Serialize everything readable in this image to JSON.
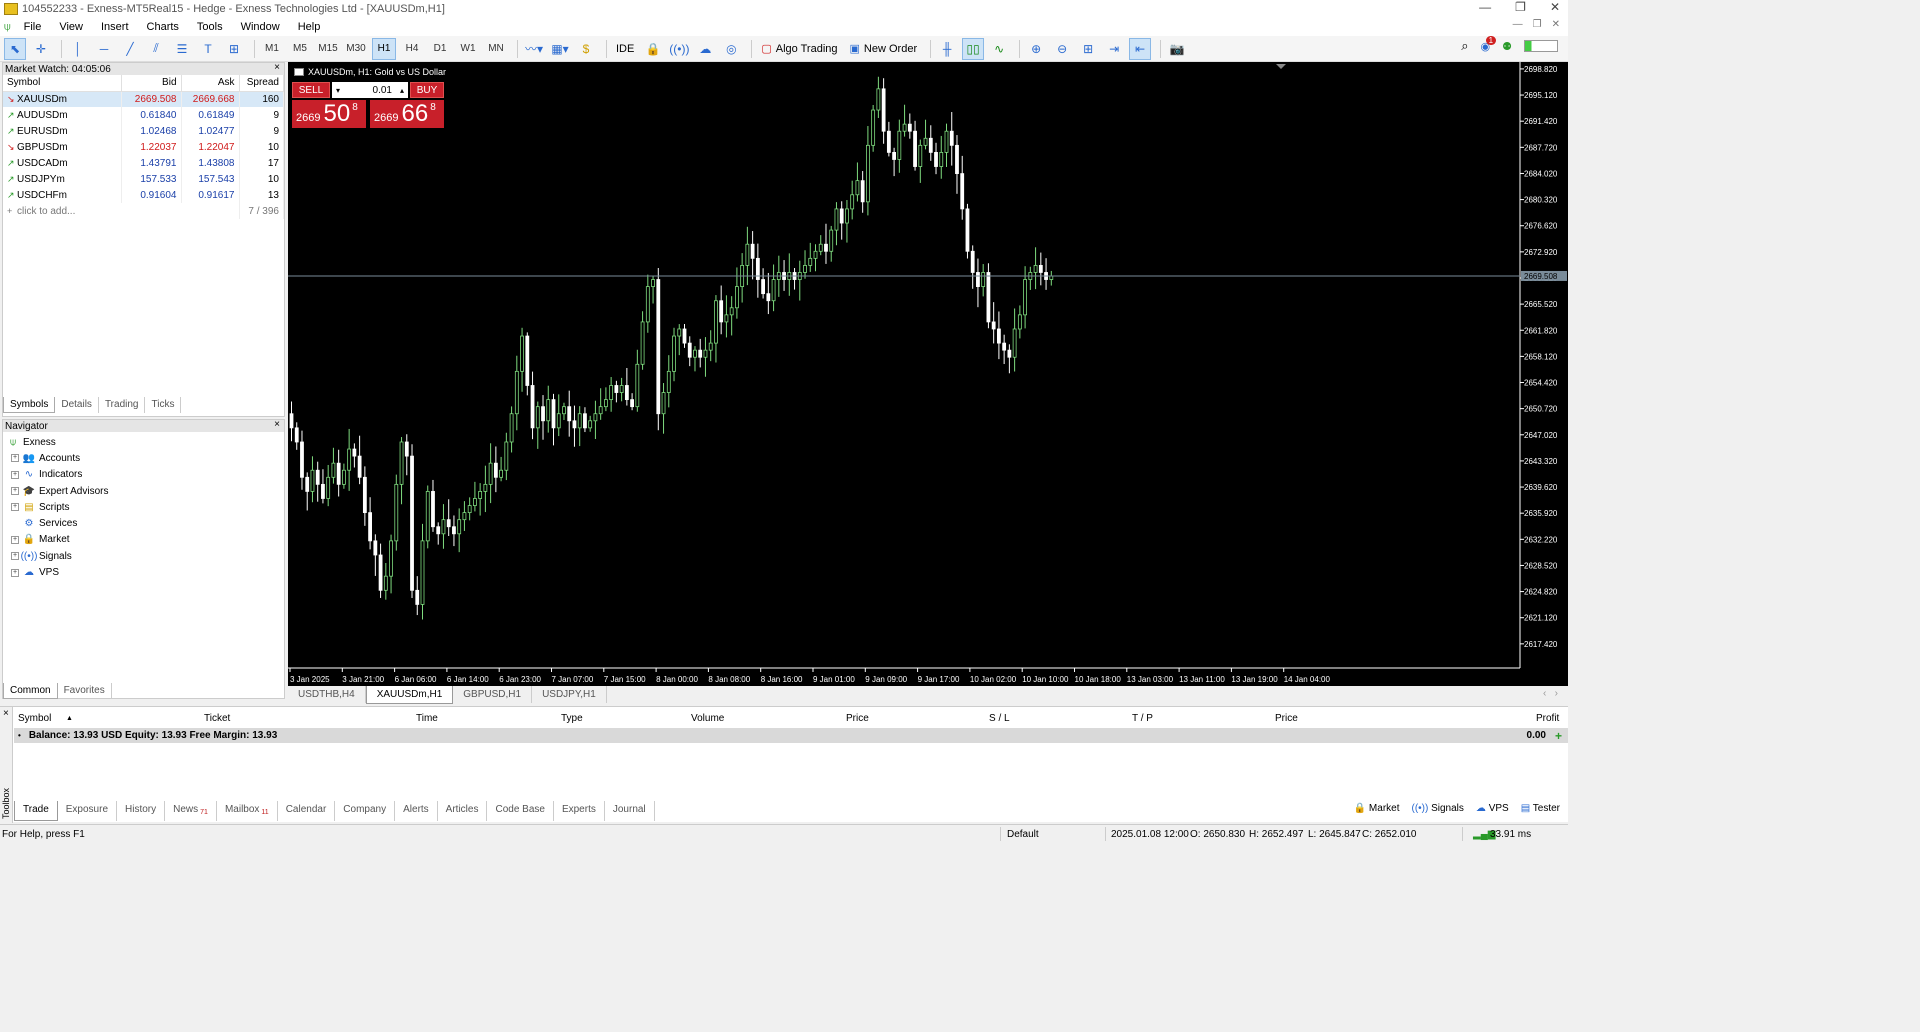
{
  "window": {
    "title": "104552233 - Exness-MT5Real15 - Hedge - Exness Technologies Ltd - [XAUUSDm,H1]",
    "min_glyph": "—",
    "restore_glyph": "❐",
    "close_glyph": "✕"
  },
  "menu": [
    "File",
    "View",
    "Insert",
    "Charts",
    "Tools",
    "Window",
    "Help"
  ],
  "toolbar": {
    "timeframes": [
      "M1",
      "M5",
      "M15",
      "M30",
      "H1",
      "H4",
      "D1",
      "W1",
      "MN"
    ],
    "active_timeframe": "H1",
    "ide_label": "IDE",
    "algo_label": "Algo Trading",
    "new_order_label": "New Order",
    "notification_count": "1"
  },
  "market_watch": {
    "title": "Market Watch: 04:05:06",
    "columns": [
      "Symbol",
      "Bid",
      "Ask",
      "Spread"
    ],
    "rows": [
      {
        "symbol": "XAUUSDm",
        "bid": "2669.508",
        "ask": "2669.668",
        "spread": "160",
        "dir": "dn"
      },
      {
        "symbol": "AUDUSDm",
        "bid": "0.61840",
        "ask": "0.61849",
        "spread": "9",
        "dir": "up"
      },
      {
        "symbol": "EURUSDm",
        "bid": "1.02468",
        "ask": "1.02477",
        "spread": "9",
        "dir": "up"
      },
      {
        "symbol": "GBPUSDm",
        "bid": "1.22037",
        "ask": "1.22047",
        "spread": "10",
        "dir": "dn"
      },
      {
        "symbol": "USDCADm",
        "bid": "1.43791",
        "ask": "1.43808",
        "spread": "17",
        "dir": "up"
      },
      {
        "symbol": "USDJPYm",
        "bid": "157.533",
        "ask": "157.543",
        "spread": "10",
        "dir": "up"
      },
      {
        "symbol": "USDCHFm",
        "bid": "0.91604",
        "ask": "0.91617",
        "spread": "13",
        "dir": "up"
      }
    ],
    "add_label": "click to add...",
    "count": "7 / 396",
    "tabs": [
      "Symbols",
      "Details",
      "Trading",
      "Ticks"
    ]
  },
  "navigator": {
    "title": "Navigator",
    "root": "Exness",
    "items": [
      "Accounts",
      "Indicators",
      "Expert Advisors",
      "Scripts",
      "Services",
      "Market",
      "Signals",
      "VPS"
    ],
    "tabs": [
      "Common",
      "Favorites"
    ]
  },
  "chart": {
    "title": "XAUUSDm, H1:  Gold vs US Dollar",
    "sell_label": "SELL",
    "buy_label": "BUY",
    "lot": "0.01",
    "sell_price": {
      "small": "2669",
      "big": "50",
      "sup": "8"
    },
    "buy_price": {
      "small": "2669",
      "big": "66",
      "sup": "8"
    },
    "current_price_label": "2669.508",
    "tabs": [
      "USDTHB,H4",
      "XAUUSDm,H1",
      "GBPUSD,H1",
      "USDJPY,H1"
    ],
    "active_tab": "XAUUSDm,H1"
  },
  "chart_data": {
    "type": "candlestick",
    "symbol": "XAUUSDm",
    "timeframe": "H1",
    "ylim": [
      2614.0,
      2699.8
    ],
    "y_ticks": [
      "2698.820",
      "2695.120",
      "2691.420",
      "2687.720",
      "2684.020",
      "2680.320",
      "2676.620",
      "2672.920",
      "2669.220",
      "2665.520",
      "2661.820",
      "2658.120",
      "2654.420",
      "2650.720",
      "2647.020",
      "2643.320",
      "2639.620",
      "2635.920",
      "2632.220",
      "2628.520",
      "2624.820",
      "2621.120",
      "2617.420"
    ],
    "x_ticks": [
      "3 Jan 2025",
      "3 Jan 21:00",
      "6 Jan 06:00",
      "6 Jan 14:00",
      "6 Jan 23:00",
      "7 Jan 07:00",
      "7 Jan 15:00",
      "8 Jan 00:00",
      "8 Jan 08:00",
      "8 Jan 16:00",
      "9 Jan 01:00",
      "9 Jan 09:00",
      "9 Jan 17:00",
      "10 Jan 02:00",
      "10 Jan 10:00",
      "10 Jan 18:00",
      "13 Jan 03:00",
      "13 Jan 11:00",
      "13 Jan 19:00",
      "14 Jan 04:00"
    ],
    "current_price": 2669.508,
    "closes": [
      2648,
      2646,
      2641,
      2639,
      2642,
      2640,
      2638,
      2641,
      2643,
      2640,
      2642,
      2645,
      2644,
      2641,
      2636,
      2632,
      2630,
      2625,
      2627,
      2632,
      2640,
      2646,
      2644,
      2625,
      2623,
      2632,
      2639,
      2634,
      2633,
      2635,
      2634,
      2633,
      2635,
      2636,
      2637,
      2638,
      2639,
      2640,
      2643,
      2641,
      2642,
      2646,
      2650,
      2656,
      2661,
      2654,
      2648,
      2651,
      2649,
      2652,
      2648,
      2650,
      2651,
      2649,
      2648,
      2650,
      2648,
      2649,
      2650,
      2651,
      2652,
      2654,
      2653,
      2654,
      2652,
      2651,
      2657,
      2663,
      2668,
      2669,
      2650,
      2653,
      2656,
      2661,
      2662,
      2660,
      2658,
      2659,
      2658,
      2659,
      2660,
      2666,
      2663,
      2664,
      2665,
      2668,
      2671,
      2674,
      2672,
      2669,
      2667,
      2666,
      2669,
      2670,
      2669,
      2670,
      2669,
      2670,
      2671,
      2672,
      2673,
      2674,
      2673,
      2676,
      2679,
      2677,
      2679,
      2681,
      2683,
      2680,
      2688,
      2693,
      2696,
      2690,
      2687,
      2686,
      2690,
      2691,
      2690,
      2685,
      2688,
      2689,
      2687,
      2685,
      2687,
      2690,
      2688,
      2684,
      2679,
      2673,
      2670,
      2668,
      2670,
      2663,
      2662,
      2660,
      2659,
      2658,
      2662,
      2664,
      2669,
      2670,
      2671,
      2670,
      2669,
      2669.5
    ]
  },
  "toolbox": {
    "side_label": "Toolbox",
    "columns": [
      "Symbol",
      "Ticket",
      "Time",
      "Type",
      "Volume",
      "Price",
      "S / L",
      "T / P",
      "Price",
      "Profit"
    ],
    "balance_text": "Balance: 13.93 USD  Equity: 13.93  Free Margin: 13.93",
    "profit": "0.00",
    "tabs": [
      {
        "label": "Trade",
        "badge": ""
      },
      {
        "label": "Exposure",
        "badge": ""
      },
      {
        "label": "History",
        "badge": ""
      },
      {
        "label": "News",
        "badge": "71"
      },
      {
        "label": "Mailbox",
        "badge": "11"
      },
      {
        "label": "Calendar",
        "badge": ""
      },
      {
        "label": "Company",
        "badge": ""
      },
      {
        "label": "Alerts",
        "badge": ""
      },
      {
        "label": "Articles",
        "badge": ""
      },
      {
        "label": "Code Base",
        "badge": ""
      },
      {
        "label": "Experts",
        "badge": ""
      },
      {
        "label": "Journal",
        "badge": ""
      }
    ],
    "right_tabs": [
      "Market",
      "Signals",
      "VPS",
      "Tester"
    ]
  },
  "status": {
    "help": "For Help, press F1",
    "profile": "Default",
    "datetime": "2025.01.08 12:00",
    "open": "O: 2650.830",
    "high": "H: 2652.497",
    "low": "L: 2645.847",
    "close": "C: 2652.010",
    "ping": "33.91 ms"
  },
  "colors": {
    "bull": "#7fdc7f",
    "bear": "#ffffff",
    "sell_red": "#c8202a",
    "bid_down": "#d01a1a",
    "bid_up": "#1a3fa8"
  }
}
